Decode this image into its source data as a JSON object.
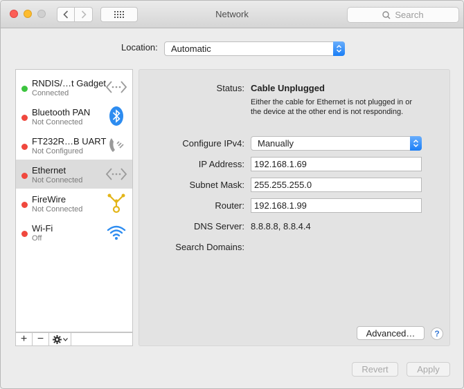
{
  "window": {
    "title": "Network"
  },
  "search": {
    "placeholder": "Search"
  },
  "location": {
    "label": "Location:",
    "value": "Automatic"
  },
  "services": [
    {
      "name": "RNDIS/…t Gadget",
      "status": "Connected",
      "status_color": "#3cc43e",
      "icon": "ethernet-arrows-icon"
    },
    {
      "name": "Bluetooth PAN",
      "status": "Not Connected",
      "status_color": "#f0483e",
      "icon": "bluetooth-icon"
    },
    {
      "name": "FT232R…B UART",
      "status": "Not Configured",
      "status_color": "#f0483e",
      "icon": "phone-modem-icon"
    },
    {
      "name": "Ethernet",
      "status": "Not Connected",
      "status_color": "#f0483e",
      "icon": "ethernet-arrows-icon",
      "selected": true
    },
    {
      "name": "FireWire",
      "status": "Not Connected",
      "status_color": "#f0483e",
      "icon": "firewire-icon"
    },
    {
      "name": "Wi-Fi",
      "status": "Off",
      "status_color": "#f0483e",
      "icon": "wifi-icon"
    }
  ],
  "sidebar_toolbar": {
    "add": "+",
    "remove": "−",
    "gear_chevron": "⌄"
  },
  "detail": {
    "status_label": "Status:",
    "status_value": "Cable Unplugged",
    "status_description": "Either the cable for Ethernet is not plugged in or the device at the other end is not responding.",
    "configure_label": "Configure IPv4:",
    "configure_value": "Manually",
    "ip_label": "IP Address:",
    "ip_value": "192.168.1.69",
    "subnet_label": "Subnet Mask:",
    "subnet_value": "255.255.255.0",
    "router_label": "Router:",
    "router_value": "192.168.1.99",
    "dns_label": "DNS Server:",
    "dns_value": "8.8.8.8, 8.8.4.4",
    "search_domains_label": "Search Domains:",
    "advanced_label": "Advanced…",
    "help_label": "?"
  },
  "footer": {
    "revert_label": "Revert",
    "apply_label": "Apply"
  },
  "colors": {
    "accent": "#1a7ef6",
    "selected_row": "#dcdcdc"
  }
}
